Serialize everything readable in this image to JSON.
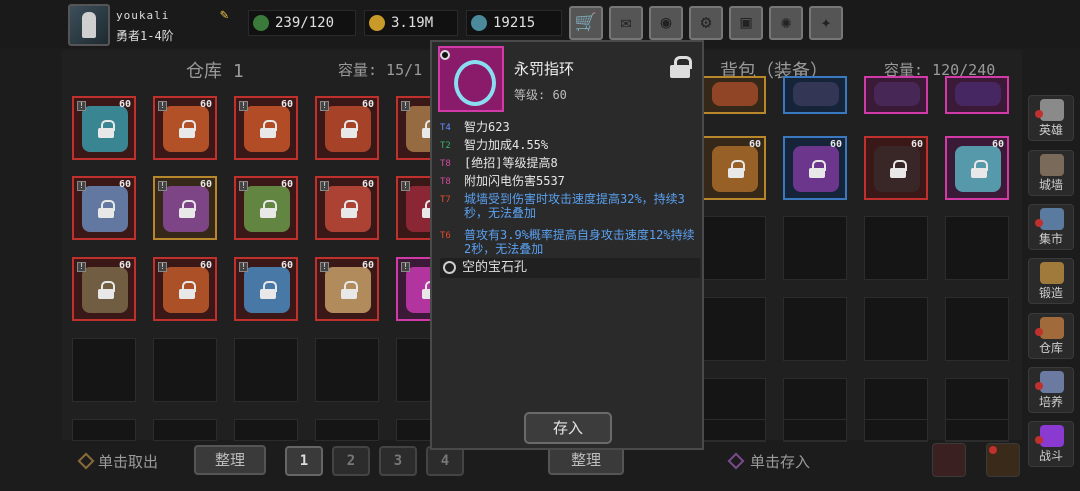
{
  "player": {
    "name": "youkali",
    "rank": "勇者1-4阶"
  },
  "resources": {
    "energy": "239/120",
    "gold": "3.19M",
    "gems": "19215"
  },
  "toolbar": [
    "cart-icon",
    "mail-icon",
    "gamepad-icon",
    "settings-icon",
    "gift-icon",
    "colorwheel-icon",
    "feather-icon"
  ],
  "warehouse": {
    "title": "仓库 1",
    "capacity_label": "容量: 15/1"
  },
  "backpack": {
    "title": "背包（装备）",
    "capacity_label": "容量: 120/240"
  },
  "warehouse_items": [
    {
      "level": "60",
      "color": "red",
      "gear": "#3a9aa8"
    },
    {
      "level": "60",
      "color": "red",
      "gear": "#c85a2a"
    },
    {
      "level": "60",
      "color": "red",
      "gear": "#c8562a"
    },
    {
      "level": "60",
      "color": "red",
      "gear": "#b84a2a"
    },
    {
      "level": "60",
      "color": "red",
      "gear": "#a87a4a"
    },
    {
      "level": "60",
      "color": "red",
      "gear": "#6a8ab8"
    },
    {
      "level": "60",
      "color": "gold",
      "gear": "#8a4a9a"
    },
    {
      "level": "60",
      "color": "red",
      "gear": "#6a9a4a"
    },
    {
      "level": "60",
      "color": "red",
      "gear": "#c04a3a"
    },
    {
      "level": "60",
      "color": "red",
      "gear": "#9a2a3a"
    },
    {
      "level": "60",
      "color": "red",
      "gear": "#7a6a4a"
    },
    {
      "level": "60",
      "color": "red",
      "gear": "#c05a2a"
    },
    {
      "level": "60",
      "color": "red",
      "gear": "#4a8ac0"
    },
    {
      "level": "60",
      "color": "red",
      "gear": "#c8a06a"
    },
    {
      "level": "60",
      "color": "pink",
      "gear": "#c83ab0"
    }
  ],
  "backpack_items": [
    {
      "level": "",
      "color": "gold",
      "gear": "#a04a2a"
    },
    {
      "level": "",
      "color": "blue",
      "gear": "#3a3a5a"
    },
    {
      "level": "",
      "color": "pink",
      "gear": "#4a2a5a"
    },
    {
      "level": "",
      "color": "pink",
      "gear": "#4a2a6a"
    },
    {
      "level": "60",
      "color": "gold",
      "gear": "#a86a2a"
    },
    {
      "level": "60",
      "color": "blue",
      "gear": "#7a3a9a"
    },
    {
      "level": "60",
      "color": "red",
      "gear": "#3a2a2a"
    },
    {
      "level": "60",
      "color": "pink",
      "gear": "#5ab0c0"
    }
  ],
  "bottom": {
    "take_out": "单击取出",
    "sort_left": "整理",
    "pages": [
      "1",
      "2",
      "3",
      "4"
    ],
    "sort_right": "整理",
    "store": "单击存入"
  },
  "sidebar": [
    {
      "label": "英雄",
      "icon_color": "#8a8a8a",
      "alert": true
    },
    {
      "label": "城墙",
      "icon_color": "#7a6a5a",
      "alert": false
    },
    {
      "label": "集市",
      "icon_color": "#5a7aa0",
      "alert": true
    },
    {
      "label": "锻造",
      "icon_color": "#a07a3a",
      "alert": false
    },
    {
      "label": "仓库",
      "icon_color": "#a06a3a",
      "alert": true
    },
    {
      "label": "培养",
      "icon_color": "#6a7aa0",
      "alert": true
    },
    {
      "label": "战斗",
      "icon_color": "#8a3ad0",
      "alert": true
    }
  ],
  "tooltip": {
    "name": "永罚指环",
    "level": "等级: 60",
    "stats": [
      {
        "tier": "T4",
        "text": "智力623",
        "cls": "t4 w"
      },
      {
        "tier": "T2",
        "text": "智力加成4.55%",
        "cls": "t2 w"
      },
      {
        "tier": "T8",
        "text": "[绝招]等级提高8",
        "cls": "t8 w"
      },
      {
        "tier": "T8",
        "text": "附加闪电伤害5537",
        "cls": "t8 w"
      },
      {
        "tier": "T7",
        "text": "城墙受到伤害时攻击速度提高32%，持续3秒，无法叠加",
        "cls": "t7 b"
      },
      {
        "tier": "T6",
        "text": "普攻有3.9%概率提高自身攻击速度12%持续2秒，无法叠加",
        "cls": "t6 b"
      }
    ],
    "socket": "空的宝石孔",
    "store_button": "存入"
  }
}
